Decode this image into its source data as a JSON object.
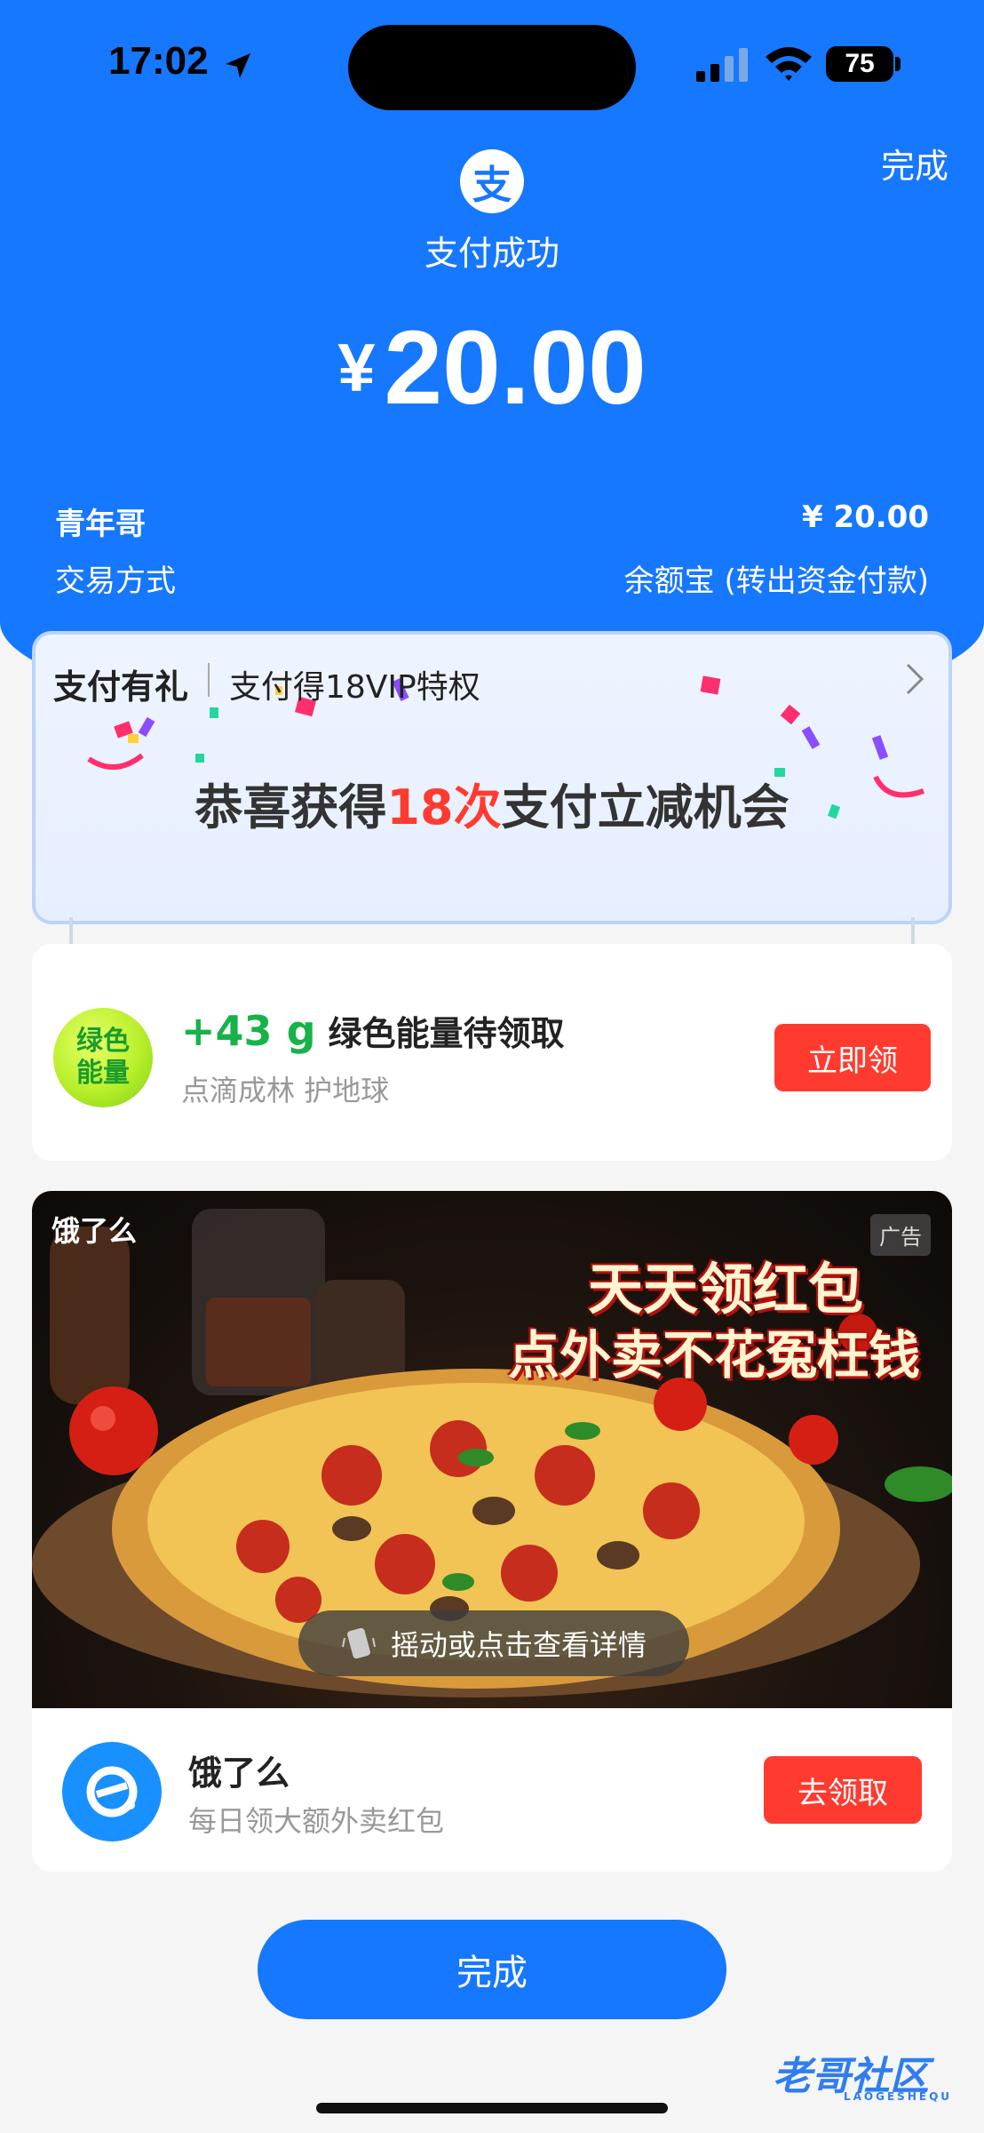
{
  "status_bar": {
    "time": "17:02",
    "battery": "75"
  },
  "header": {
    "done_label": "完成",
    "pay_logo_char": "支",
    "title": "支付成功",
    "currency": "¥",
    "amount": "20.00"
  },
  "details": {
    "payee": "青年哥",
    "payee_amount": "¥ 20.00",
    "method_label": "交易方式",
    "method_value": "余额宝 (转出资金付款)"
  },
  "promo": {
    "title": "支付有礼",
    "subtitle": "支付得18VIP特权",
    "main_pre": "恭喜获得",
    "main_highlight": "18次",
    "main_post": "支付立减机会"
  },
  "energy": {
    "ball_text_1": "绿色",
    "ball_text_2": "能量",
    "amount": "+43 g",
    "title": "绿色能量待领取",
    "subtitle": "点滴成林 护地球",
    "button": "立即领"
  },
  "ad": {
    "brand": "饿了么",
    "tag": "广告",
    "headline_1": "天天领红包",
    "headline_2": "点外卖不花冤枉钱",
    "shake_text": "摇动或点击查看详情",
    "title": "饿了么",
    "subtitle": "每日领大额外卖红包",
    "button": "去领取"
  },
  "footer": {
    "done_button": "完成"
  },
  "watermark": {
    "text": "老哥社区",
    "sub": "LAOGESHEQU"
  },
  "colors": {
    "primary": "#1677ff",
    "danger": "#ff3b30",
    "energy_green": "#17b34a"
  }
}
